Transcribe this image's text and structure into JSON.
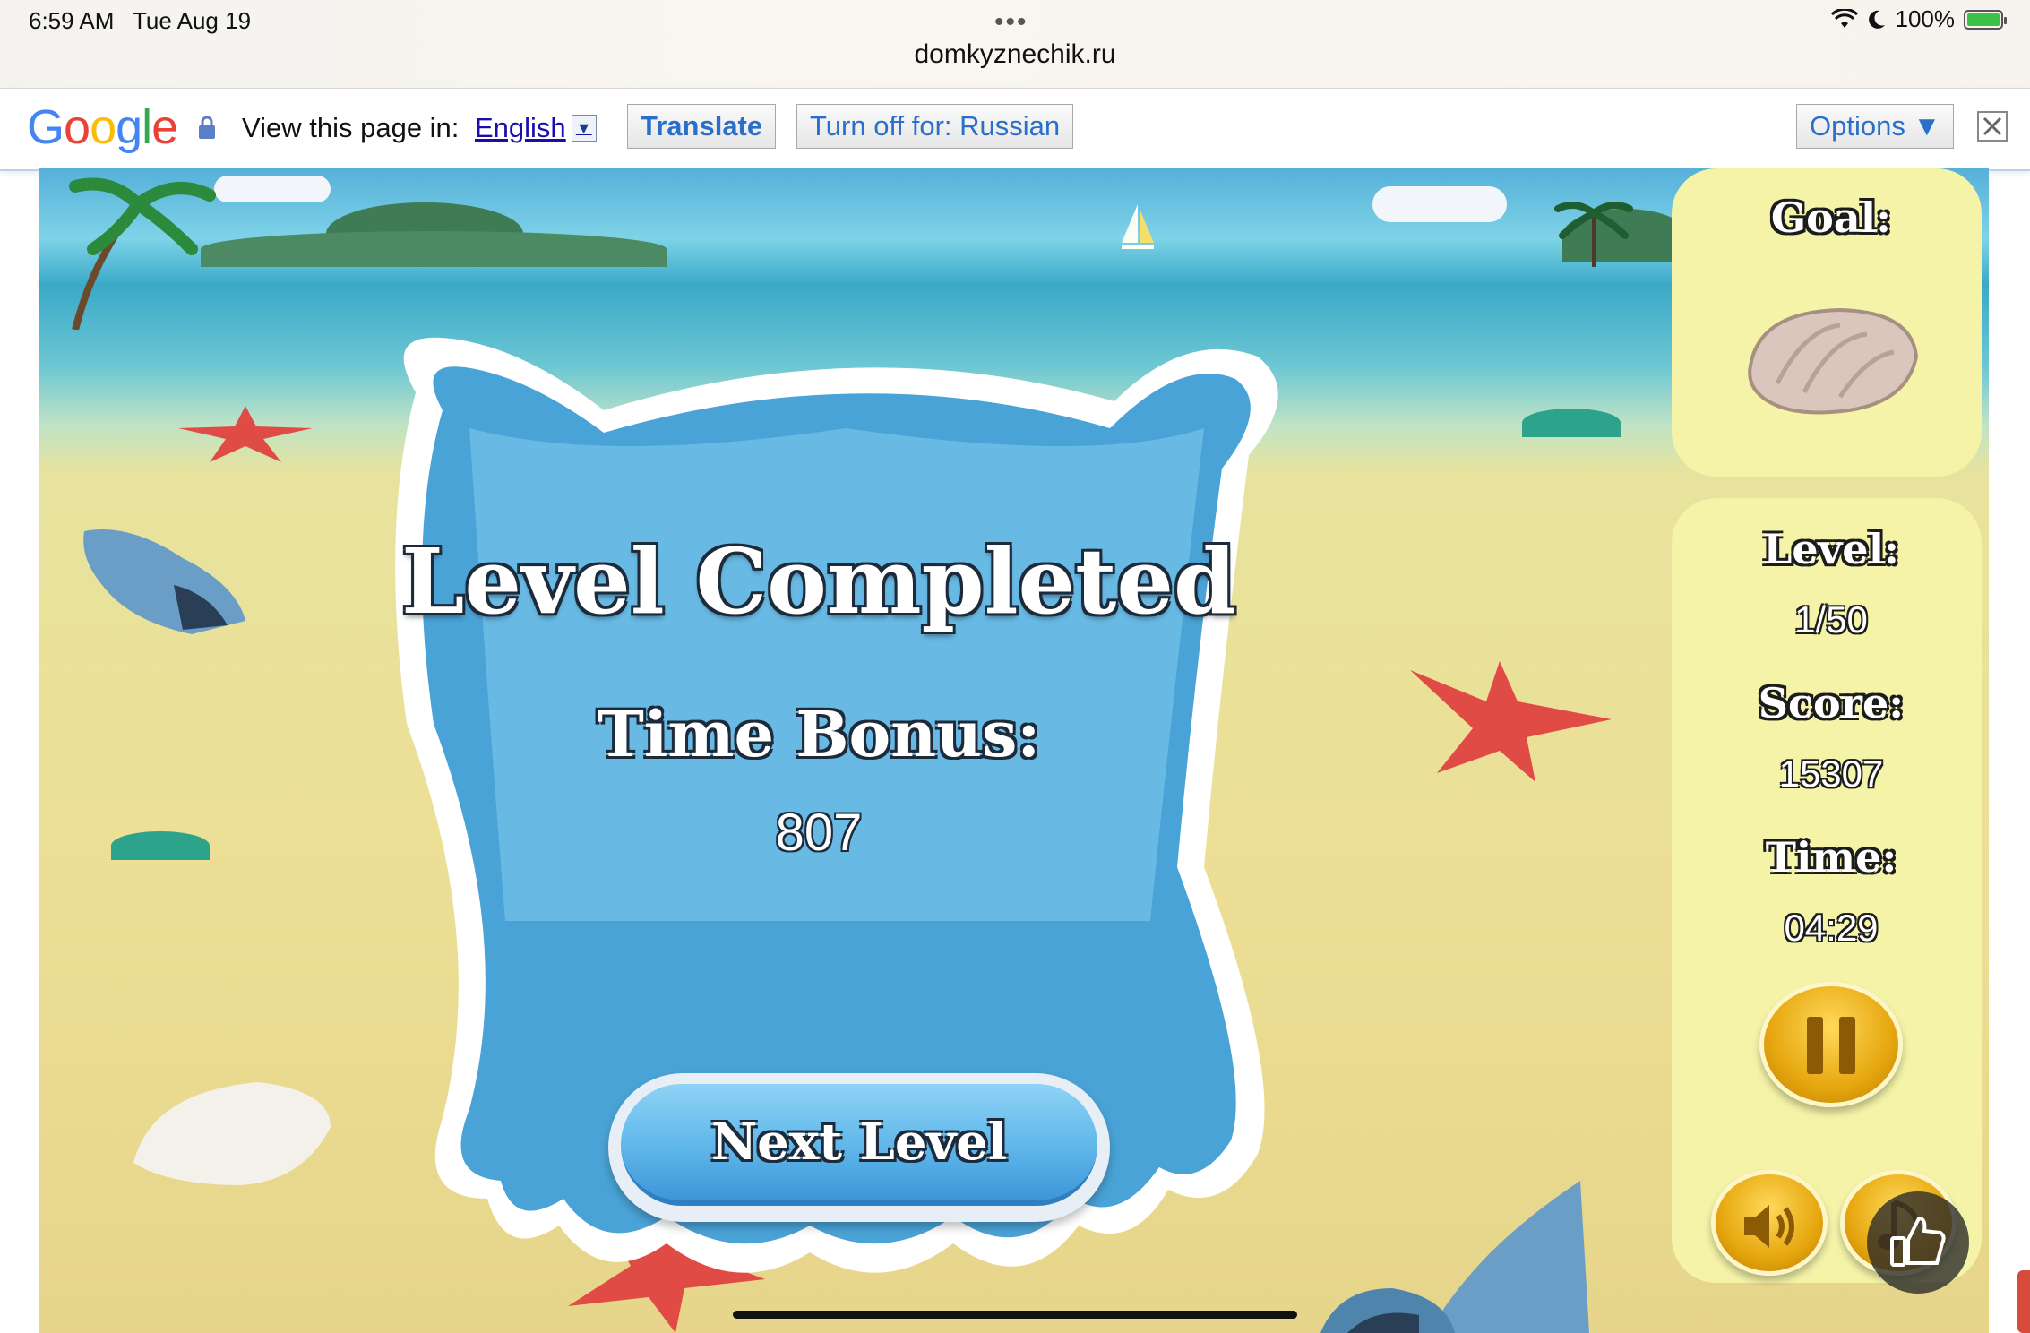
{
  "status_bar": {
    "time": "6:59 AM",
    "date": "Tue Aug 19",
    "battery": "100%",
    "url": "domkyznechik.ru"
  },
  "translate_bar": {
    "logo": "Google",
    "view_text": "View this page in:",
    "language": "English",
    "translate_button": "Translate",
    "turn_off_button": "Turn off for: Russian",
    "options_button": "Options ▼"
  },
  "game": {
    "title": "Level Completed",
    "bonus_label": "Time Bonus:",
    "bonus_value": "807",
    "next_button": "Next Level"
  },
  "side_panel": {
    "goal_label": "Goal:",
    "level_label": "Level:",
    "level_value": "1/50",
    "score_label": "Score:",
    "score_value": "15307",
    "time_label": "Time:",
    "time_value": "04:29"
  },
  "icons": [
    "wifi-icon",
    "moon-icon",
    "battery-icon",
    "lock-icon",
    "close-icon",
    "shell-icon",
    "pause-icon",
    "sound-icon",
    "music-icon",
    "thumbs-up-icon"
  ],
  "colors": {
    "accent_blue": "#2a6fc9",
    "panel_yellow": "#f4f3a8",
    "button_gold": "#e6a70f",
    "frame_blue": "#4aa3d6"
  }
}
